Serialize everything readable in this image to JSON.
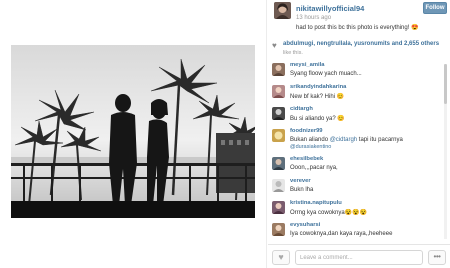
{
  "post": {
    "username": "nikitawillyofficial94",
    "timestamp": "13 hours ago",
    "caption": "had to post this bc this photo is everything! 😍",
    "follow_label": "Follow"
  },
  "likes": {
    "names": "abdulmugi, nengtrullala, yusronumits",
    "count_text": "and 2,655 others",
    "more_text": "like this."
  },
  "comments": [
    {
      "user": "meysi_amila",
      "text": "Syang floow yach muach..."
    },
    {
      "user": "srikandyindahkarina",
      "text": "New bf kak? Hihi 😊"
    },
    {
      "user": "cidtargh",
      "text": "Bu si aliando ya? 😊"
    },
    {
      "user": "foodnizer99",
      "text": "Bukan aliando ",
      "mention": "@cidtargh",
      "text_after": " tapi itu pacarnya",
      "extra": "@durasiakentino"
    },
    {
      "user": "ehesilbebek",
      "text": "Ooon,,,pacar nya,"
    },
    {
      "user": "verever",
      "text": "Bukn lha"
    },
    {
      "user": "kristina.napitupulu",
      "text": "Orrng kya cowoknya😵😵😵"
    },
    {
      "user": "evysuharsi",
      "text": "Iya cowoknya,dan kaya raya,,heeheee"
    }
  ],
  "footer": {
    "comment_placeholder": "Leave a comment...",
    "more_label": "•••",
    "like_icon": "heart-icon"
  },
  "colors": {
    "link": "#3f729b",
    "follow_button": "#6f97b6"
  }
}
